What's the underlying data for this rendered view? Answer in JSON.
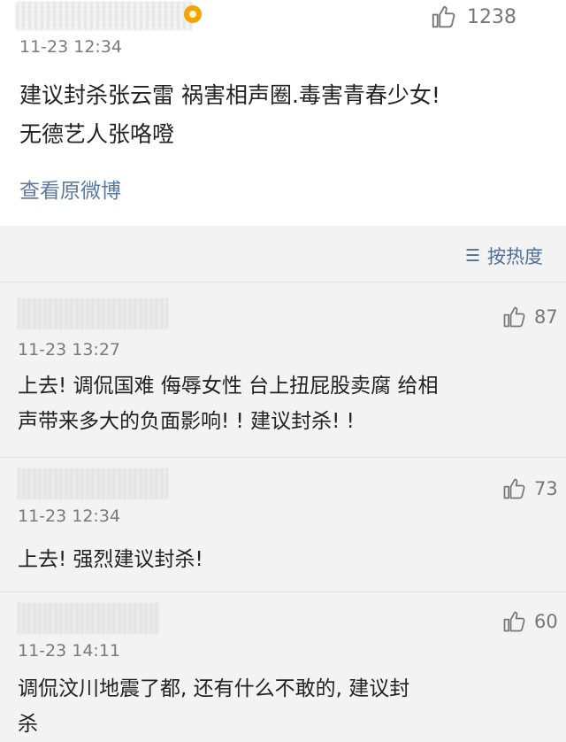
{
  "top_comment": {
    "time": "11-23 12:34",
    "like_count": "1238",
    "text_line1": "建议封杀张云雷  祸害相声圈.毒害青春少女!",
    "text_line2": "无德艺人张咯噔",
    "view_original": "查看原微博"
  },
  "sort": {
    "label": "按热度",
    "icon": "sort-lines-icon"
  },
  "comments": [
    {
      "time": "11-23 13:27",
      "like_count": "87",
      "text_line1": "上去! 调侃国难 侮辱女性 台上扭屁股卖腐 给相",
      "text_line2": "声带来多大的负面影响! ! 建议封杀! !"
    },
    {
      "time": "11-23 12:34",
      "like_count": "73",
      "text_line1": "上去! 强烈建议封杀!",
      "text_line2": ""
    },
    {
      "time": "11-23 14:11",
      "like_count": "60",
      "text_line1": "调侃汶川地震了都, 还有什么不敢的, 建议封",
      "text_line2": "杀"
    }
  ],
  "colors": {
    "link": "#5b7aa3",
    "background": "#f3f3f3",
    "card": "#ffffff"
  }
}
